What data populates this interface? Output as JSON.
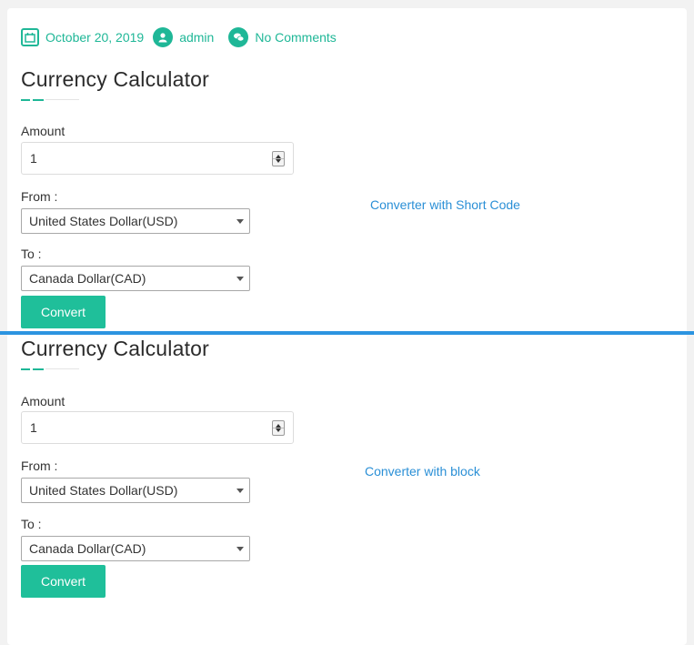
{
  "meta": {
    "date": "October 20, 2019",
    "author": "admin",
    "comments": "No Comments",
    "date_icon": "calendar-icon",
    "author_icon": "user-icon",
    "comments_icon": "chat-bubbles-icon"
  },
  "converters": [
    {
      "title": "Currency Calculator",
      "amount_label": "Amount",
      "amount_value": "1",
      "from_label": "From :",
      "from_value": "United States Dollar(USD)",
      "to_label": "To :",
      "to_value": "Canada Dollar(CAD)",
      "button_label": "Convert",
      "note": "Converter with Short Code"
    },
    {
      "title": "Currency Calculator",
      "amount_label": "Amount",
      "amount_value": "1",
      "from_label": "From :",
      "from_value": "United States Dollar(USD)",
      "to_label": "To :",
      "to_value": "Canada Dollar(CAD)",
      "button_label": "Convert",
      "note": "Converter with block"
    }
  ],
  "colors": {
    "accent": "#1fbf9a",
    "divider": "#2c94e0",
    "note": "#2a8fd6"
  }
}
